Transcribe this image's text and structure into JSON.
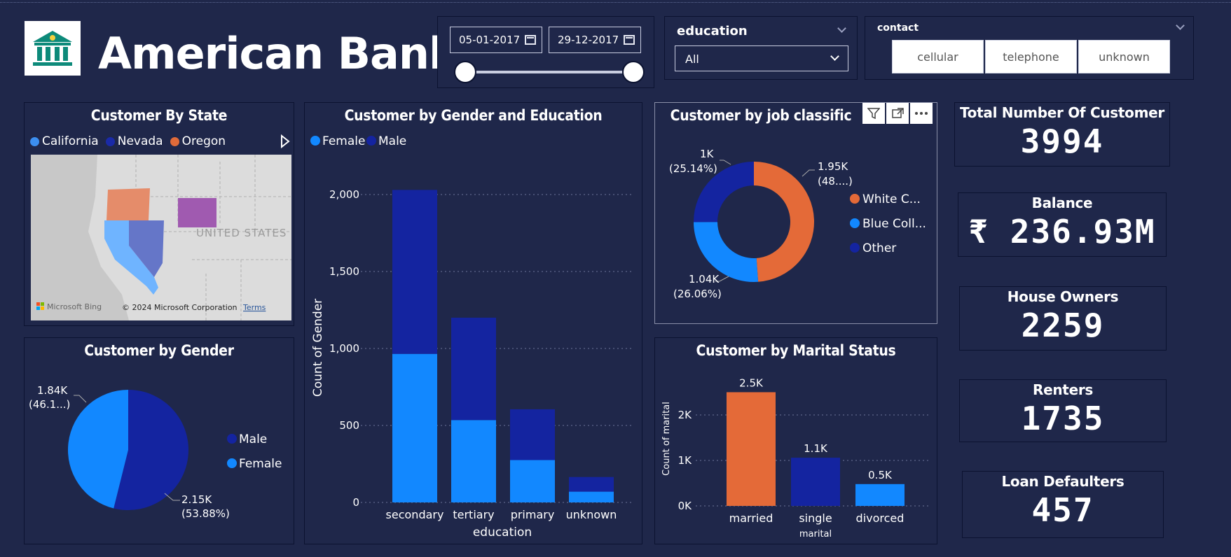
{
  "app": {
    "title": "American Bank",
    "logo_icon": "bank-building-icon",
    "accent": "#0d8a7a"
  },
  "date_filter": {
    "start_date": "05-01-2017",
    "end_date": "29-12-2017",
    "icon": "calendar-icon"
  },
  "education_filter": {
    "label": "education",
    "selected": "All"
  },
  "contact_filter": {
    "label": "contact",
    "options": [
      "cellular",
      "telephone",
      "unknown"
    ]
  },
  "kpis": {
    "total_customers": {
      "label": "Total Number Of Customer",
      "value": "3994"
    },
    "balance": {
      "label": "Balance",
      "value": "₹ 236.93M"
    },
    "house_owners": {
      "label": "House Owners",
      "value": "2259"
    },
    "renters": {
      "label": "Renters",
      "value": "1735"
    },
    "loan_defaulters": {
      "label": "Loan Defaulters",
      "value": "457"
    }
  },
  "map_panel": {
    "title": "Customer By State",
    "legend": [
      {
        "label": "California",
        "color": "#3c8ff0"
      },
      {
        "label": "Nevada",
        "color": "#1a2aa8"
      },
      {
        "label": "Oregon",
        "color": "#e06b3a"
      }
    ],
    "map_label": "UNITED STATES",
    "attribution_brand": "Microsoft Bing",
    "copyright": "© 2024 Microsoft Corporation",
    "terms": "Terms"
  },
  "colors": {
    "female": "#1288ff",
    "male": "#1424a0",
    "orange": "#e46a38",
    "background": "#1f274a"
  },
  "chart_data": [
    {
      "id": "gender-pie",
      "type": "pie",
      "title": "Customer by Gender",
      "legend": [
        "Male",
        "Female"
      ],
      "slices": [
        {
          "name": "Male",
          "value": 2150,
          "label": "2.15K",
          "pct_label": "(53.88%)",
          "color": "#1424a0"
        },
        {
          "name": "Female",
          "value": 1840,
          "label": "1.84K",
          "pct_label": "(46.1...)",
          "color": "#1288ff"
        }
      ]
    },
    {
      "id": "gender-education",
      "type": "bar",
      "stacked": true,
      "title": "Customer by Gender and Education",
      "xlabel": "education",
      "ylabel": "Count of Gender",
      "ylim": [
        0,
        2000
      ],
      "yticks": [
        "0",
        "500",
        "1,000",
        "1,500",
        "2,000"
      ],
      "categories": [
        "secondary",
        "tertiary",
        "primary",
        "unknown"
      ],
      "series": [
        {
          "name": "Female",
          "color": "#1288ff",
          "values": [
            965,
            535,
            275,
            70
          ]
        },
        {
          "name": "Male",
          "color": "#1424a0",
          "values": [
            1065,
            665,
            330,
            95
          ]
        }
      ]
    },
    {
      "id": "job-donut",
      "type": "pie",
      "title": "Customer by job classific",
      "slices": [
        {
          "name": "White C...",
          "value": 1950,
          "label": "1.95K",
          "pct_label": "(48....)",
          "color": "#e46a38"
        },
        {
          "name": "Blue Coll...",
          "value": 1040,
          "label": "1.04K",
          "pct_label": "(26.06%)",
          "color": "#1288ff"
        },
        {
          "name": "Other",
          "value": 1000,
          "label": "1K",
          "pct_label": "(25.14%)",
          "color": "#1424a0"
        }
      ]
    },
    {
      "id": "marital-bar",
      "type": "bar",
      "title": "Customer by Marital Status",
      "xlabel": "marital",
      "ylabel": "Count of marital",
      "ylim": [
        0,
        2500
      ],
      "yticks": [
        "0K",
        "1K",
        "2K"
      ],
      "categories": [
        "married",
        "single",
        "divorced"
      ],
      "values": [
        2500,
        1060,
        480
      ],
      "labels": [
        "2.5K",
        "1.1K",
        "0.5K"
      ],
      "colors": [
        "#e46a38",
        "#1424a0",
        "#1288ff"
      ]
    }
  ]
}
